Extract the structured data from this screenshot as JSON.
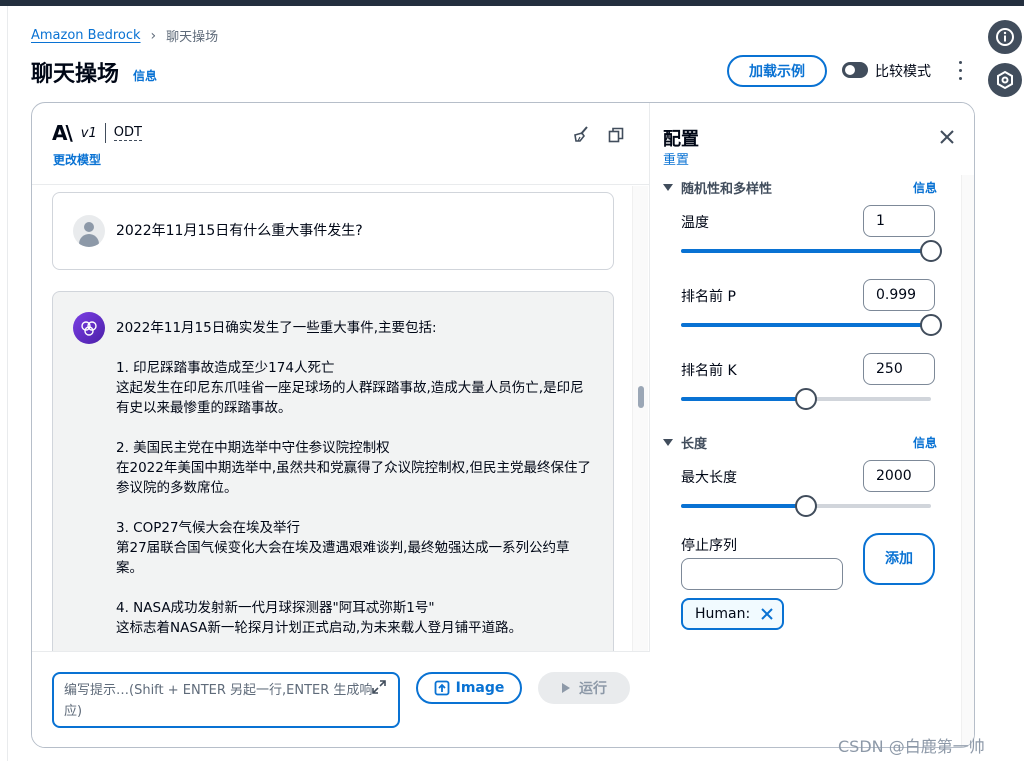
{
  "breadcrumb": {
    "root": "Amazon Bedrock",
    "current": "聊天操场"
  },
  "page": {
    "title": "聊天操场",
    "info": "信息"
  },
  "header_actions": {
    "load_examples": "加载示例",
    "compare_mode": "比较模式"
  },
  "chat": {
    "model": {
      "logo_a": "A\\",
      "logo_version": "v1",
      "logo_odt": "ODT",
      "change_model": "更改模型"
    },
    "user_message": "2022年11月15日有什么重大事件发生?",
    "ai_message": {
      "intro": "2022年11月15日确实发生了一些重大事件,主要包括:",
      "items": [
        {
          "title": "1. 印尼踩踏事故造成至少174人死亡",
          "body": "这起发生在印尼东爪哇省一座足球场的人群踩踏事故,造成大量人员伤亡,是印尼有史以来最惨重的踩踏事故。"
        },
        {
          "title": "2. 美国民主党在中期选举中守住参议院控制权",
          "body": "在2022年美国中期选举中,虽然共和党赢得了众议院控制权,但民主党最终保住了参议院的多数席位。"
        },
        {
          "title": "3. COP27气候大会在埃及举行",
          "body": "第27届联合国气候变化大会在埃及遭遇艰难谈判,最终勉强达成一系列公约草案。"
        },
        {
          "title": "4. NASA成功发射新一代月球探测器\"阿耳忒弥斯1号\"",
          "body": "这标志着NASA新一轮探月计划正式启动,为未来载人登月铺平道路。"
        }
      ]
    },
    "composer": {
      "placeholder": "编写提示…(Shift + ENTER 另起一行,ENTER 生成响应)",
      "image_label": "Image",
      "run_label": "运行"
    }
  },
  "config": {
    "title": "配置",
    "reset": "重置",
    "randomness": {
      "header": "随机性和多样性",
      "info": "信息",
      "temperature": {
        "label": "温度",
        "value": "1",
        "fraction": 1.0
      },
      "top_p": {
        "label": "排名前 P",
        "value": "0.999",
        "fraction": 0.999
      },
      "top_k": {
        "label": "排名前 K",
        "value": "250",
        "fraction": 0.5
      }
    },
    "length": {
      "header": "长度",
      "info": "信息",
      "max_length": {
        "label": "最大长度",
        "value": "2000",
        "fraction": 0.5
      },
      "stop_sequences": {
        "label": "停止序列",
        "add_label": "添加",
        "tokens": [
          "Human:"
        ]
      }
    }
  },
  "watermark": "CSDN @白鹿第一帅",
  "colors": {
    "accent": "#0972d3",
    "topbar": "#232f3e",
    "ai_avatar": "#6a2fd6"
  }
}
